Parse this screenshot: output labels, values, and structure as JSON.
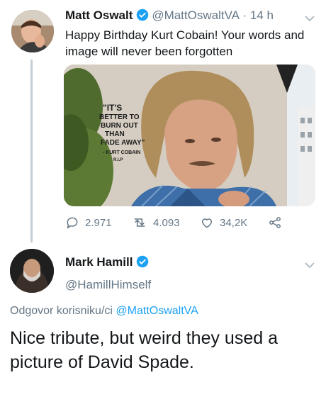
{
  "tweet": {
    "author_name": "Matt Oswalt",
    "author_handle": "@MattOswaltVA",
    "time": "· 14 h",
    "text": "Happy Birthday Kurt Cobain! Your words and image will never been forgotten",
    "mural_text": [
      "\"IT'S",
      "BETTER TO",
      "BURN OUT",
      "THAN",
      "FADE AWAY\"",
      "- KURT COBAIN",
      "R.I.P"
    ],
    "actions": {
      "replies": "2.971",
      "retweets": "4.093",
      "likes": "34,2K"
    }
  },
  "reply": {
    "author_name": "Mark Hamill",
    "author_handle": "@HamillHimself",
    "replying_prefix": "Odgovor korisniku/ci",
    "replying_to": "@MattOswaltVA",
    "text": "Nice tribute, but weird they used a picture of David Spade."
  },
  "icons": [
    "verified-badge-icon",
    "chevron-down-icon",
    "reply-icon",
    "retweet-icon",
    "like-icon",
    "share-icon"
  ],
  "colors": {
    "verified": "#1da1f2",
    "secondary_text": "#657786",
    "thread_line": "#c4cfd6"
  }
}
